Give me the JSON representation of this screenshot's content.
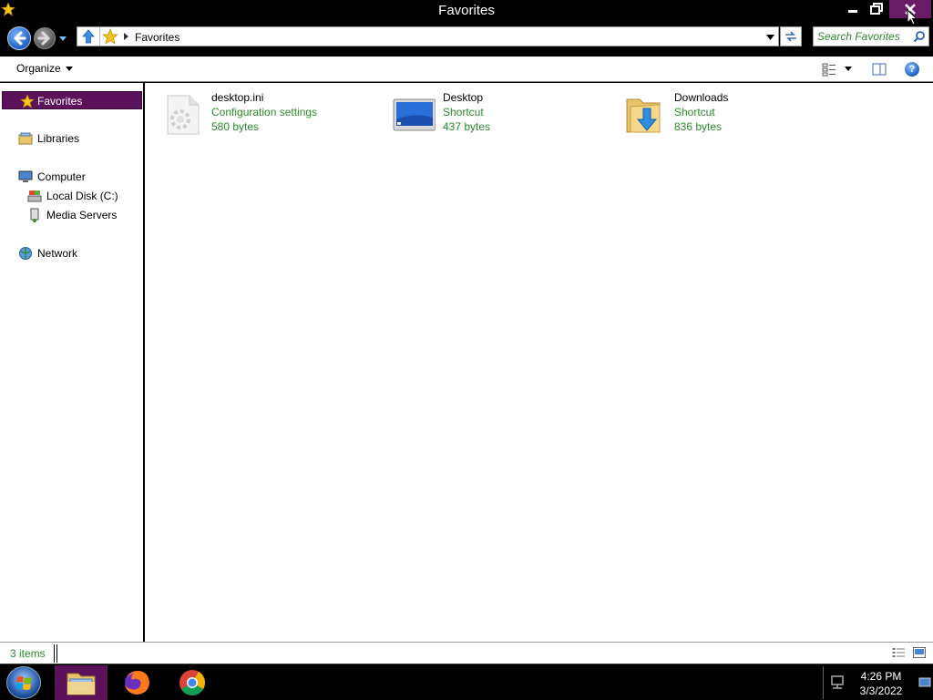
{
  "window": {
    "title": "Favorites",
    "controls": {
      "minimize": "minimize",
      "maximize": "restore",
      "close": "close"
    },
    "accent": "#5c125a"
  },
  "address_bar": {
    "breadcrumb": [
      "Favorites"
    ],
    "search_placeholder": "Search Favorites"
  },
  "toolbar": {
    "organize_label": "Organize"
  },
  "nav_pane": {
    "items": [
      {
        "label": "Favorites",
        "icon": "star-icon",
        "selected": true
      },
      {
        "label": "Libraries",
        "icon": "libraries-icon",
        "selected": false
      },
      {
        "label": "Computer",
        "icon": "computer-icon",
        "selected": false
      },
      {
        "label": "Local Disk (C:)",
        "icon": "local-disk-icon",
        "selected": false
      },
      {
        "label": "Media Servers",
        "icon": "media-server-icon",
        "selected": false
      },
      {
        "label": "Network",
        "icon": "network-icon",
        "selected": false
      }
    ]
  },
  "files": [
    {
      "name": "desktop.ini",
      "type": "Configuration settings",
      "size": "580 bytes",
      "icon": "config-file-icon"
    },
    {
      "name": "Desktop",
      "type": "Shortcut",
      "size": "437 bytes",
      "icon": "desktop-icon"
    },
    {
      "name": "Downloads",
      "type": "Shortcut",
      "size": "836 bytes",
      "icon": "downloads-folder-icon"
    }
  ],
  "status_bar": {
    "item_count": "3 items"
  },
  "taskbar": {
    "apps": [
      "File Explorer",
      "Firefox",
      "Chrome"
    ],
    "active_app": "File Explorer",
    "clock_time": "4:26 PM",
    "clock_date": "3/3/2022"
  }
}
